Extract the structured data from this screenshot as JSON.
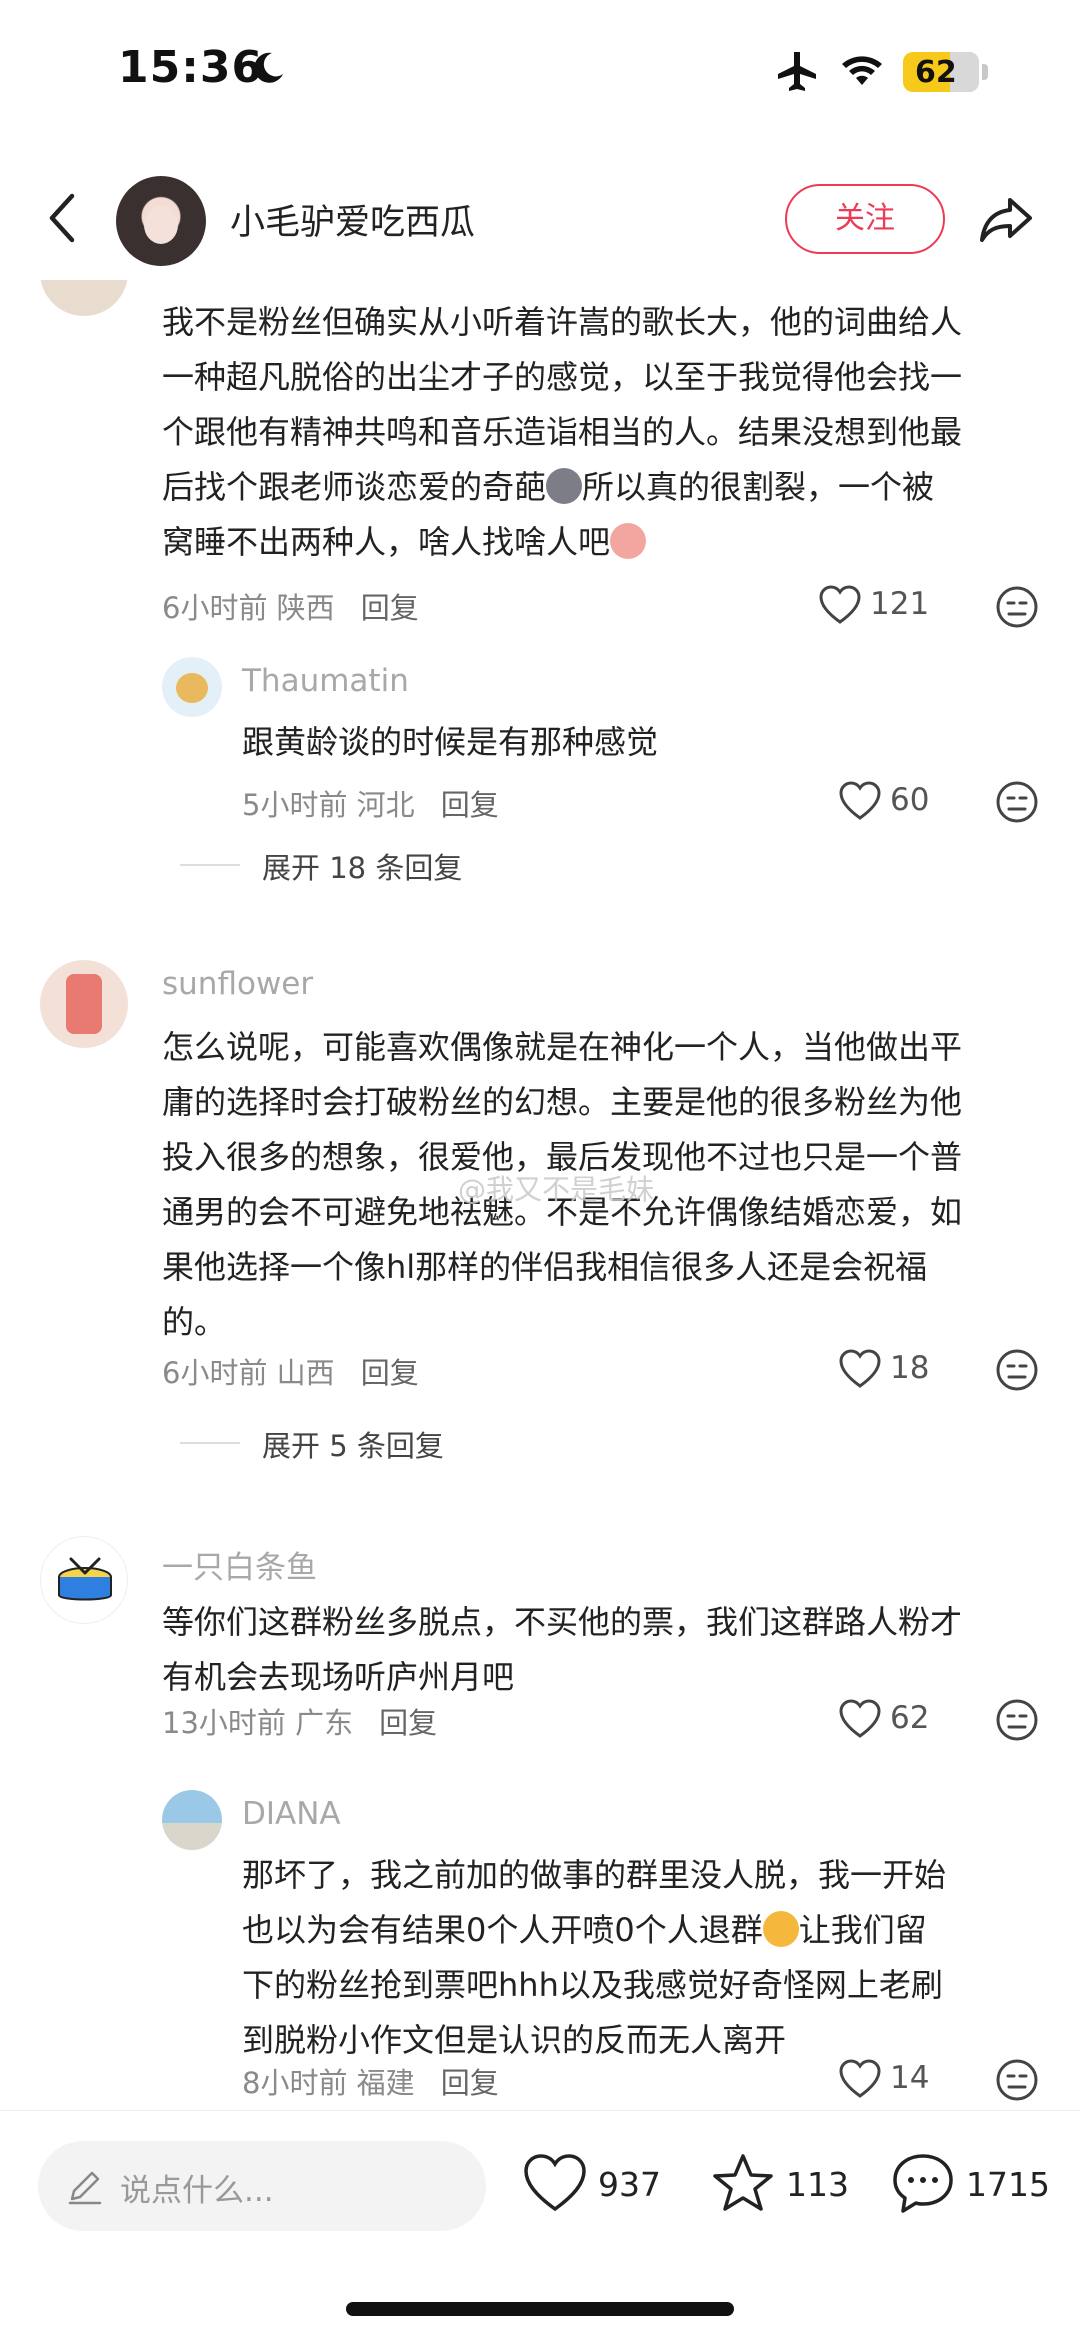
{
  "status": {
    "time": "15:36",
    "battery": "62",
    "battery_level_percent": 62
  },
  "header": {
    "name": "小毛驴爱吃西瓜",
    "follow_label": "关注"
  },
  "comments": [
    {
      "username": "",
      "text_lines": [
        "我不是粉丝但确实从小听着许嵩的歌长大，他的词曲给人",
        "一种超凡脱俗的出尘才子的感觉，以至于我觉得他会找一",
        "个跟他有精神共鸣和音乐造诣相当的人。结果没想到他最",
        "后找个跟老师谈恋爱的奇葩",
        "所以真的很割裂，一个被",
        "窝睡不出两种人，啥人找啥人吧"
      ],
      "time": "6小时前",
      "location": "陕西",
      "reply_label": "回复",
      "likes": "121"
    },
    {
      "username": "Thaumatin",
      "text_lines": [
        "跟黄龄谈的时候是有那种感觉"
      ],
      "time": "5小时前",
      "location": "河北",
      "reply_label": "回复",
      "likes": "60"
    },
    {
      "username": "sunflower",
      "text_lines": [
        "怎么说呢，可能喜欢偶像就是在神化一个人，当他做出平",
        "庸的选择时会打破粉丝的幻想。主要是他的很多粉丝为他",
        "投入很多的想象，很爱他，最后发现他不过也只是一个普",
        "通男的会不可避免地祛魅。不是不允许偶像结婚恋爱，如",
        "果他选择一个像hl那样的伴侣我相信很多人还是会祝福",
        "的。"
      ],
      "time": "6小时前",
      "location": "山西",
      "reply_label": "回复",
      "likes": "18"
    },
    {
      "username": "一只白条鱼",
      "text_lines": [
        "等你们这群粉丝多脱点，不买他的票，我们这群路人粉才",
        "有机会去现场听庐州月吧"
      ],
      "time": "13小时前",
      "location": "广东",
      "reply_label": "回复",
      "likes": "62"
    },
    {
      "username": "DIANA",
      "text_lines": [
        "那坏了，我之前加的做事的群里没人脱，我一开始",
        "也以为会有结果0个人开喷0个人退群",
        "让我们留",
        "下的粉丝抢到票吧hhh以及我感觉好奇怪网上老刷",
        "到脱粉小作文但是认识的反而无人离开"
      ],
      "time": "8小时前",
      "location": "福建",
      "reply_label": "回复",
      "likes": "14"
    }
  ],
  "expand": [
    "展开 18 条回复",
    "展开 5 条回复"
  ],
  "watermark": "@我又不是毛妹",
  "bottom": {
    "placeholder": "说点什么...",
    "likes": "937",
    "favorites": "113",
    "comments": "1715"
  }
}
